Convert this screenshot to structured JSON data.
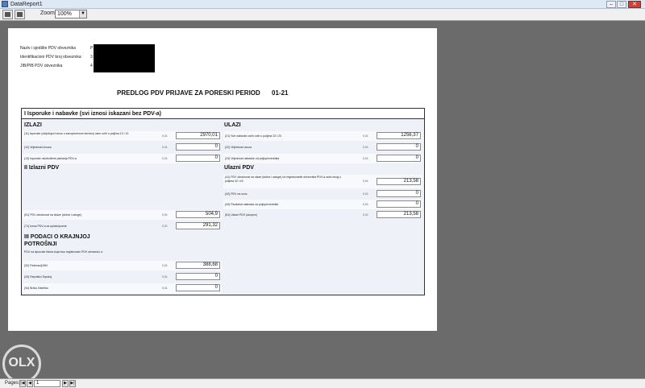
{
  "window": {
    "title": "DataReport1",
    "min_glyph": "–",
    "max_glyph": "□",
    "close_glyph": "✕"
  },
  "toolbar": {
    "zoom_label": "Zoom",
    "zoom_value": "100%",
    "zoom_arrow": "▼"
  },
  "page": {
    "taxpayer": [
      {
        "label": "Naziv i sjedište PDV obveznika",
        "value": "P"
      },
      {
        "label": "Identifikacioni PDV broj obveznika",
        "value": "3"
      },
      {
        "label": "JIB/PIB PDV obveznika",
        "value": "4"
      }
    ],
    "title": "PREDLOG PDV PRIJAVE ZA PORESKI PERIOD",
    "period": "01-21"
  },
  "form": {
    "header": "I Isporuke i nabavke (svi iznosi iskazani bez PDV-a)",
    "izlazi_title": "IZLAZI",
    "ulazi_title": "ULAZI",
    "izlazi": [
      {
        "label": "(11) Isporuke (uključujući iznos u zanopećenom servisu) osim onih u poljima 12 i 13",
        "code": "0,01",
        "value": "2970,01"
      },
      {
        "label": "(12) Vrijednost izvoza",
        "code": "0,01",
        "value": "0"
      },
      {
        "label": "(13) Isporuke oslobođene plaćanja PDV-a",
        "code": "0,01",
        "value": "0"
      }
    ],
    "ulazi": [
      {
        "label": "(21) Sve nabavke osim onih u poljima 22 i 23",
        "code": "0,01",
        "value": "1256,37"
      },
      {
        "label": "(22) Vrijednost uvoza",
        "code": "0,01",
        "value": "0"
      },
      {
        "label": "(23) Vrijednost nabavke od poljoprivrednika",
        "code": "0,01",
        "value": "0"
      }
    ],
    "izlazni_pdv_title": "II Izlazni PDV",
    "ulazni_pdv_title": "Ulazni PDV",
    "ulazni_pdv": [
      {
        "label": "(41) PDV obračunat na ulaze (dobra i usluge) od registrovanih obveznika PDV-a osim onog u poljima 42 i 43",
        "code": "0,01",
        "value": "213,58"
      },
      {
        "label": "(42) PDV na uvoz",
        "code": "0,01",
        "value": "0"
      },
      {
        "label": "(43) Paušalna naknada za poljoprivrednike",
        "code": "0,01",
        "value": "0"
      },
      {
        "label": "(61) Ulazni PDV (ukupno)",
        "code": "0,01",
        "value": "213,58"
      }
    ],
    "izlazni_pdv": [
      {
        "label": "(51) PDV obračunat na izlaze (dobra i usluge)",
        "code": "0,01",
        "value": "504,9"
      },
      {
        "label": "(71) Iznos PDV-a za uplatu/povrat",
        "code": "0,01",
        "value": "291,32"
      }
    ],
    "krajnja_title": "III PODACI O KRAJNJOJ POTROŠNJI",
    "krajnja_note": "PDV na isporuke licima koja nisu registrovani PDV obveznici u:",
    "krajnja": [
      {
        "label": "(32) Federaciji BiH",
        "code": "0,01",
        "value": "388,68"
      },
      {
        "label": "(33) Republici Srpskoj",
        "code": "0,01",
        "value": "0"
      },
      {
        "label": "(34) Brčko Distriktu",
        "code": "0,01",
        "value": "0"
      }
    ]
  },
  "status": {
    "pages_label": "Pages:",
    "first": "|◀",
    "prev": "◀",
    "page_value": "1",
    "next": "▶",
    "last": "▶|"
  },
  "watermark": {
    "text": "OLX"
  }
}
